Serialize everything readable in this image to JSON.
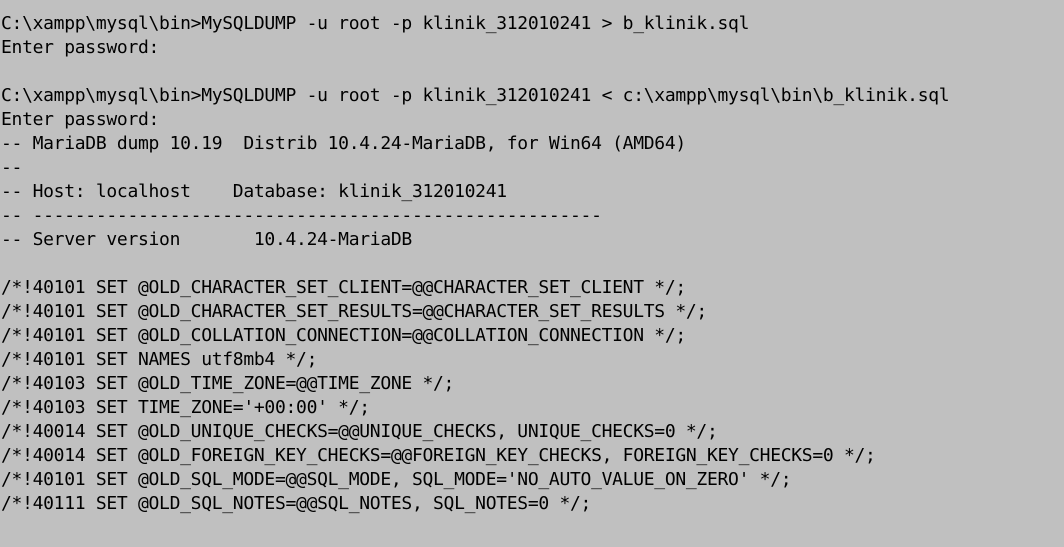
{
  "console": {
    "lines": [
      "C:\\xampp\\mysql\\bin>MySQLDUMP -u root -p klinik_312010241 > b_klinik.sql",
      "Enter password:",
      "",
      "C:\\xampp\\mysql\\bin>MySQLDUMP -u root -p klinik_312010241 < c:\\xampp\\mysql\\bin\\b_klinik.sql",
      "Enter password:",
      "-- MariaDB dump 10.19  Distrib 10.4.24-MariaDB, for Win64 (AMD64)",
      "--",
      "-- Host: localhost    Database: klinik_312010241",
      "-- ------------------------------------------------------",
      "-- Server version       10.4.24-MariaDB",
      "",
      "/*!40101 SET @OLD_CHARACTER_SET_CLIENT=@@CHARACTER_SET_CLIENT */;",
      "/*!40101 SET @OLD_CHARACTER_SET_RESULTS=@@CHARACTER_SET_RESULTS */;",
      "/*!40101 SET @OLD_COLLATION_CONNECTION=@@COLLATION_CONNECTION */;",
      "/*!40101 SET NAMES utf8mb4 */;",
      "/*!40103 SET @OLD_TIME_ZONE=@@TIME_ZONE */;",
      "/*!40103 SET TIME_ZONE='+00:00' */;",
      "/*!40014 SET @OLD_UNIQUE_CHECKS=@@UNIQUE_CHECKS, UNIQUE_CHECKS=0 */;",
      "/*!40014 SET @OLD_FOREIGN_KEY_CHECKS=@@FOREIGN_KEY_CHECKS, FOREIGN_KEY_CHECKS=0 */;",
      "/*!40101 SET @OLD_SQL_MODE=@@SQL_MODE, SQL_MODE='NO_AUTO_VALUE_ON_ZERO' */;",
      "/*!40111 SET @OLD_SQL_NOTES=@@SQL_NOTES, SQL_NOTES=0 */;"
    ]
  },
  "colors": {
    "background": "#c0c0c0",
    "text": "#000000"
  }
}
